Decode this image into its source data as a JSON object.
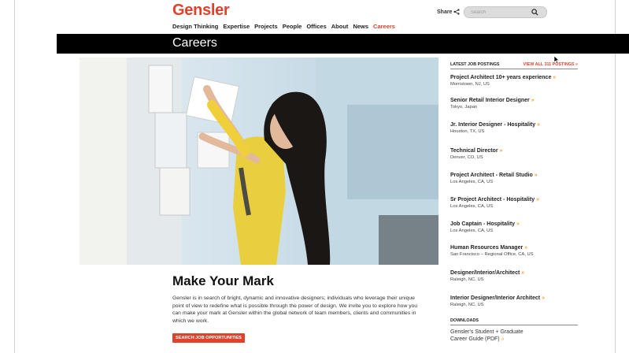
{
  "header": {
    "logo": "Gensler",
    "share_label": "Share",
    "search_placeholder": "Search"
  },
  "nav": [
    "Design Thinking",
    "Expertise",
    "Projects",
    "People",
    "Offices",
    "About",
    "News",
    "Careers"
  ],
  "nav_active": "Careers",
  "page_title": "Careers",
  "main": {
    "headline": "Make Your Mark",
    "intro": "Gensler is in search of bright, dynamic and innovative designers; individuals who leverage their unique point of view to redefine what is possible through the power of design. We invite you to explore how you can make your mark at Gensler within the global network of team members, clients and communities in which we work.",
    "cta": "SEARCH JOB OPPORTUNITIES"
  },
  "sidebar": {
    "latest_label": "LATEST JOB POSTINGS",
    "view_all": "VIEW ALL 311 POSTINGS »",
    "postings": [
      {
        "title": "Project Architect 10+ years experience",
        "location": "Morristown, NJ, US"
      },
      {
        "title": "Senior Retail Interior Designer",
        "location": "Tokyo, Japan"
      },
      {
        "title": "Jr. Interior Designer - Hospitality",
        "location": "Houston, TX, US"
      },
      {
        "title": "Technical Director",
        "location": "Denver, CO, US"
      },
      {
        "title": "Project Architect - Retail Studio",
        "location": "Los Angeles, CA, US"
      },
      {
        "title": "Sr Project Architect - Hospitality",
        "location": "Los Angeles, CA, US"
      },
      {
        "title": "Job Captain - Hospitality",
        "location": "Los Angeles, CA, US"
      },
      {
        "title": "Human Resources Manager",
        "location": "San Francisco – Regional Office, CA, US"
      },
      {
        "title": "Designer/Interior/Architect",
        "location": "Raleigh, NC, US"
      },
      {
        "title": "Interior Designer/Interior Architect",
        "location": "Raleigh, NC, US"
      }
    ],
    "downloads_label": "DOWNLOADS",
    "download_line1": "Gensler's Student + Graduate",
    "download_line2": "Career Guide (PDF)"
  },
  "colors": {
    "brand": "#e0412b",
    "accent_arrow": "#f2a23a",
    "titlebar": "#000000"
  }
}
